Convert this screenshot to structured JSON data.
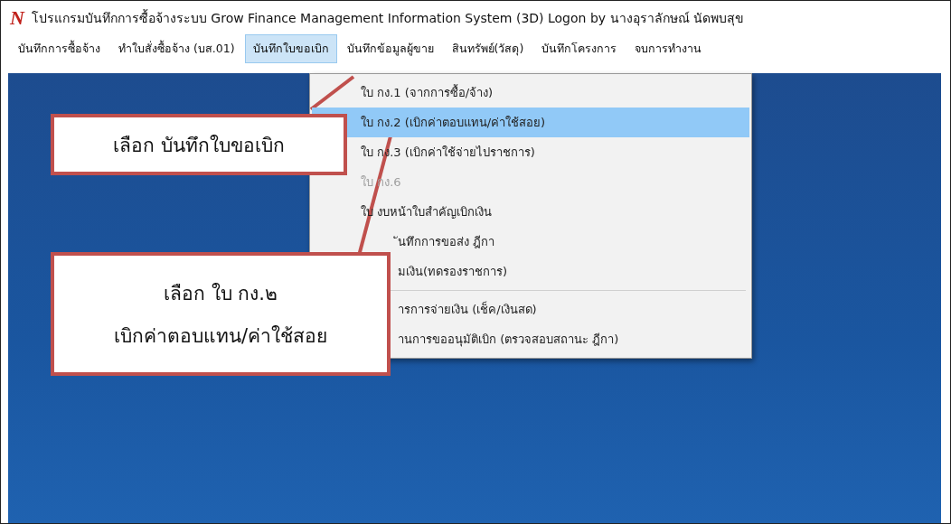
{
  "window": {
    "logo": "N",
    "title": "โปรแกรมบันทึกการซื้อจ้างระบบ  Grow Finance Management Information System (3D) Logon by นางอุราลักษณ์ นัดพบสุข"
  },
  "menu_bar": [
    {
      "label": "บันทึกการซื้อจ้าง",
      "selected": false
    },
    {
      "label": "ทำใบสั่งซื้อจ้าง (บส.01)",
      "selected": false
    },
    {
      "label": "บันทึกใบขอเบิก",
      "selected": true
    },
    {
      "label": "บันทึกข้อมูลผู้ขาย",
      "selected": false
    },
    {
      "label": "สินทรัพย์(วัสดุ)",
      "selected": false
    },
    {
      "label": "บันทึกโครงการ",
      "selected": false
    },
    {
      "label": "จบการทำงาน",
      "selected": false
    }
  ],
  "dropdown": [
    {
      "kind": "item",
      "label": "ใบ กง.1 (จากการซื้อ/จ้าง)",
      "selected": false,
      "disabled": false
    },
    {
      "kind": "item",
      "label": "ใบ กง.2 (เบิกค่าตอบแทน/ค่าใช้สอย)",
      "selected": true,
      "disabled": false
    },
    {
      "kind": "item",
      "label": "ใบ กง.3 (เบิกค่าใช้จ่ายไปราชการ)",
      "selected": false,
      "disabled": false
    },
    {
      "kind": "item",
      "label": "ใบ กง.6",
      "selected": false,
      "disabled": true
    },
    {
      "kind": "item",
      "label": "ใบ งบหน้าใบสำคัญเบิกเงิน",
      "selected": false,
      "disabled": false
    },
    {
      "kind": "partial",
      "label": "ันทึกการขอส่ง ฎีกา",
      "selected": false,
      "disabled": false
    },
    {
      "kind": "partial",
      "label": "มเงิน(ทดรองราชการ)",
      "selected": false,
      "disabled": false
    },
    {
      "kind": "separator"
    },
    {
      "kind": "partial",
      "label": "ารการจ่ายเงิน (เช็ค/เงินสด)",
      "selected": false,
      "disabled": false
    },
    {
      "kind": "partial",
      "label": "านการขออนุมัติเบิก (ตรวจสอบสถานะ ฎีกา)",
      "selected": false,
      "disabled": false
    }
  ],
  "callouts": [
    {
      "lines": [
        "เลือก บันทึกใบขอเบิก"
      ]
    },
    {
      "lines": [
        "เลือก ใบ กง.๒",
        "เบิกค่าตอบแทน/ค่าใช้สอย"
      ]
    }
  ]
}
